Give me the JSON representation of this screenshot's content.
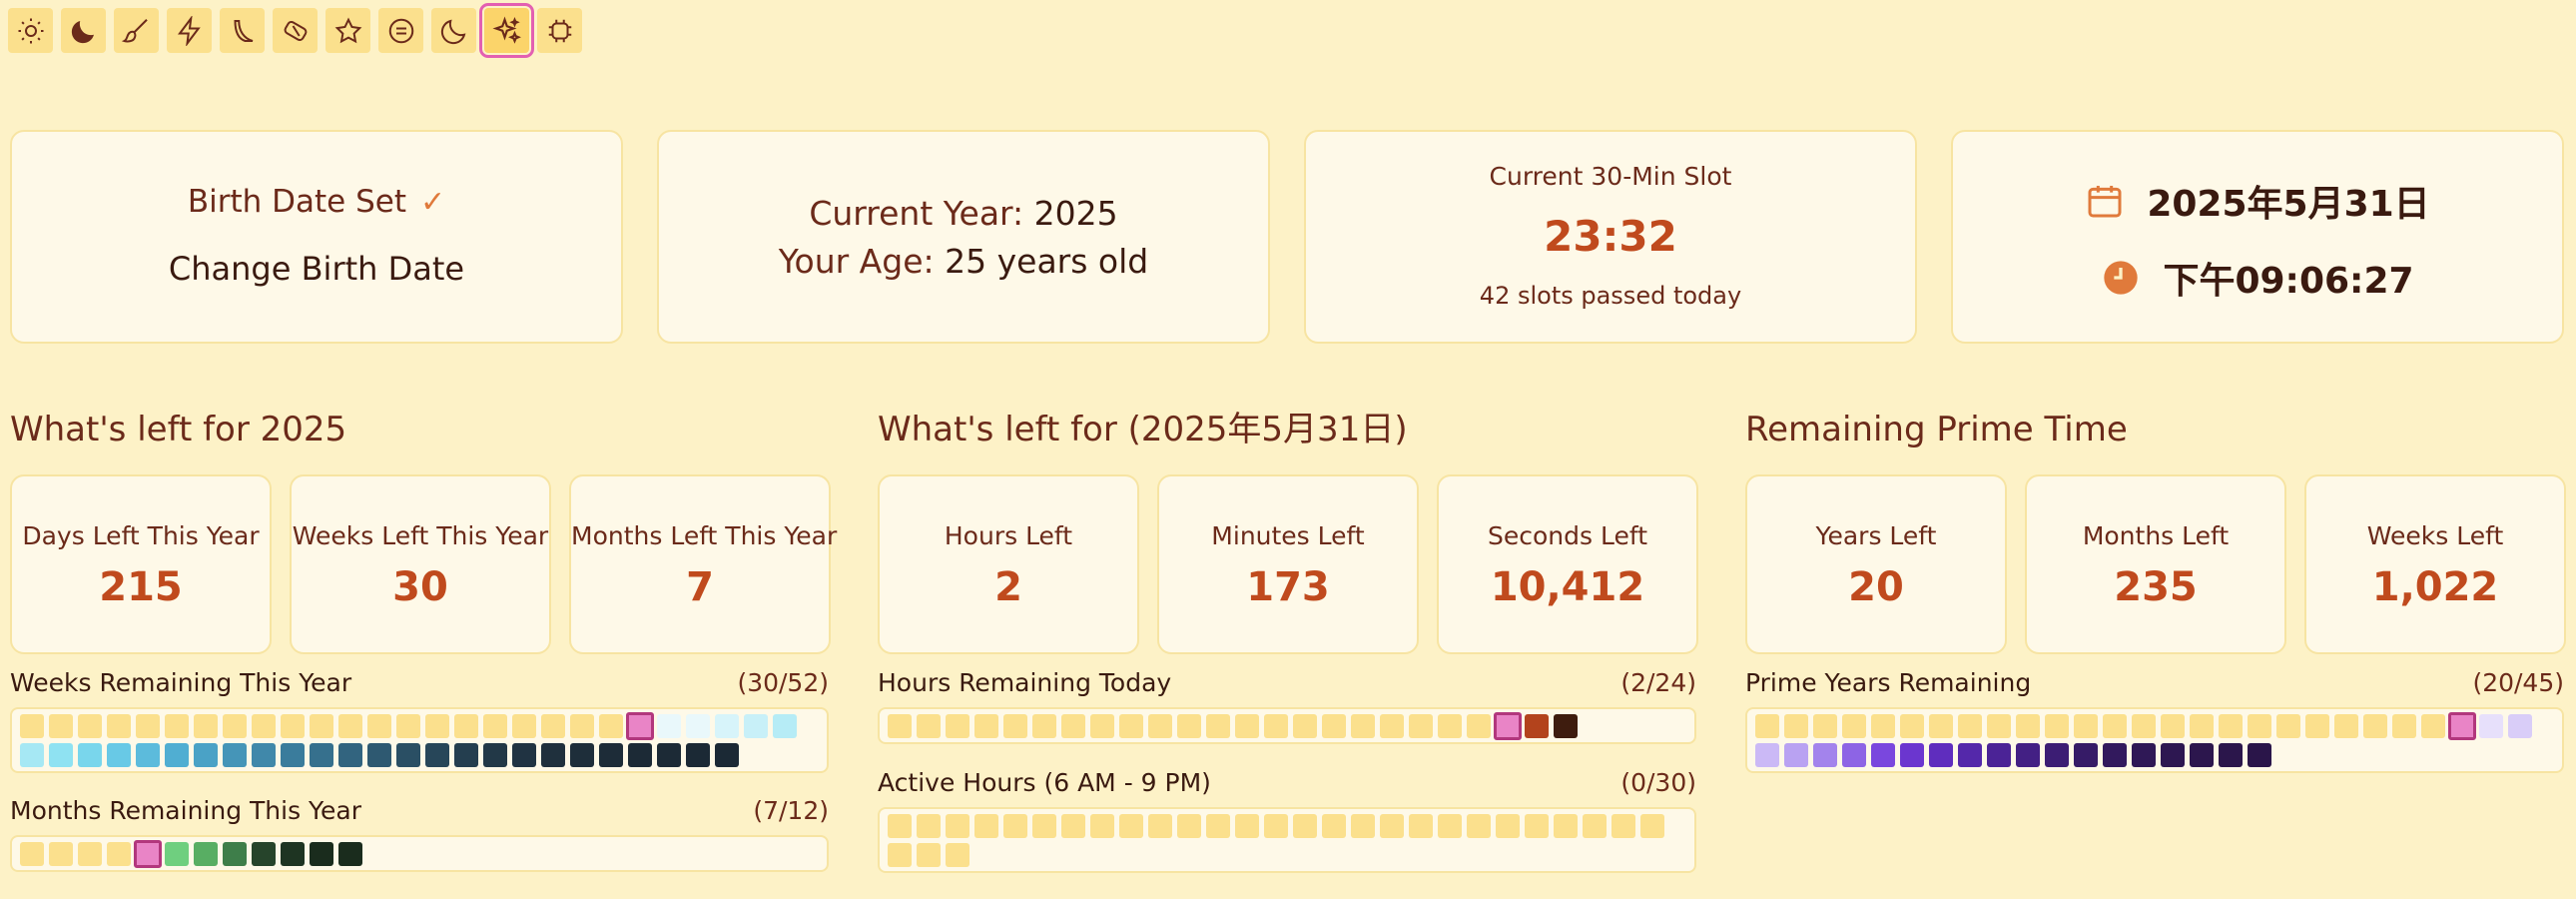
{
  "toolbar": {
    "icons": [
      "sun-icon",
      "moon-filled-icon",
      "brush-icon",
      "lightning-icon",
      "blade-icon",
      "eraser-icon",
      "star-icon",
      "minus-circle-icon",
      "moon-outline-icon",
      "sparkles-icon",
      "chip-icon"
    ],
    "active_index": 9
  },
  "birth": {
    "title": "Birth Date Set",
    "check": "✓",
    "change": "Change Birth Date"
  },
  "current": {
    "year_label": "Current Year:",
    "year_value": "2025",
    "age_label": "Your Age:",
    "age_value": "25 years old"
  },
  "slot": {
    "label": "Current 30-Min Slot",
    "time": "23:32",
    "sub": "42 slots passed today"
  },
  "datetime": {
    "date": "2025年5月31日",
    "time": "下午09:06:27"
  },
  "sections": {
    "year": {
      "title": "What's left for 2025",
      "stats": [
        {
          "label": "Days Left This Year",
          "value": "215"
        },
        {
          "label": "Weeks Left This Year",
          "value": "30"
        },
        {
          "label": "Months Left This Year",
          "value": "7"
        }
      ],
      "grids": [
        {
          "label": "Weeks Remaining This Year",
          "count": "(30/52)"
        },
        {
          "label": "Months Remaining This Year",
          "count": "(7/12)"
        }
      ]
    },
    "day": {
      "title": "What's left for (2025年5月31日)",
      "stats": [
        {
          "label": "Hours Left",
          "value": "2"
        },
        {
          "label": "Minutes Left",
          "value": "173"
        },
        {
          "label": "Seconds Left",
          "value": "10,412"
        }
      ],
      "grids": [
        {
          "label": "Hours Remaining Today",
          "count": "(2/24)"
        },
        {
          "label": "Active Hours (6 AM - 9 PM)",
          "count": "(0/30)"
        }
      ]
    },
    "prime": {
      "title": "Remaining Prime Time",
      "stats": [
        {
          "label": "Years Left",
          "value": "20"
        },
        {
          "label": "Months Left",
          "value": "235"
        },
        {
          "label": "Weeks Left",
          "value": "1,022"
        }
      ],
      "grids": [
        {
          "label": "Prime Years Remaining",
          "count": "(20/45)"
        }
      ]
    }
  },
  "colors": {
    "passed": "#fbe08d",
    "current": "#e984c6",
    "weeks": [
      "#e9f8fb",
      "#e9f8fb",
      "#d7f4fa",
      "#c8f0f8",
      "#b6ecf6",
      "#a6e8f4",
      "#8fe2f2",
      "#79d6ec",
      "#68c9e6",
      "#5cbbdc",
      "#50aed2",
      "#4aa2c6",
      "#4595b8",
      "#4088aa",
      "#3a7c9c",
      "#36708d",
      "#32647f",
      "#2e5971",
      "#2a4f64",
      "#274659",
      "#243e4f",
      "#223847",
      "#203342",
      "#1f303d",
      "#1e2e3a",
      "#1d2c38",
      "#1c2a36",
      "#1c2a36",
      "#1b2935",
      "#1b2935"
    ],
    "months": [
      "#6fcf7f",
      "#58ae63",
      "#3e7e4a",
      "#26442b",
      "#1e3422",
      "#1a2c1d"
    ],
    "hours": [
      "#b3431c",
      "#3e1c0e"
    ],
    "prime": [
      "#e7e0fb",
      "#d9cdf8",
      "#cbb9f6",
      "#b9a2f2",
      "#a383ec",
      "#8d64e5",
      "#7a47de",
      "#6b36cf",
      "#5f2dbe",
      "#5428aa",
      "#4b2396",
      "#432084",
      "#3c1d74",
      "#361b67",
      "#32195d",
      "#2f1856",
      "#2d1751",
      "#2c164d",
      "#2b164b",
      "#2a1549"
    ]
  }
}
